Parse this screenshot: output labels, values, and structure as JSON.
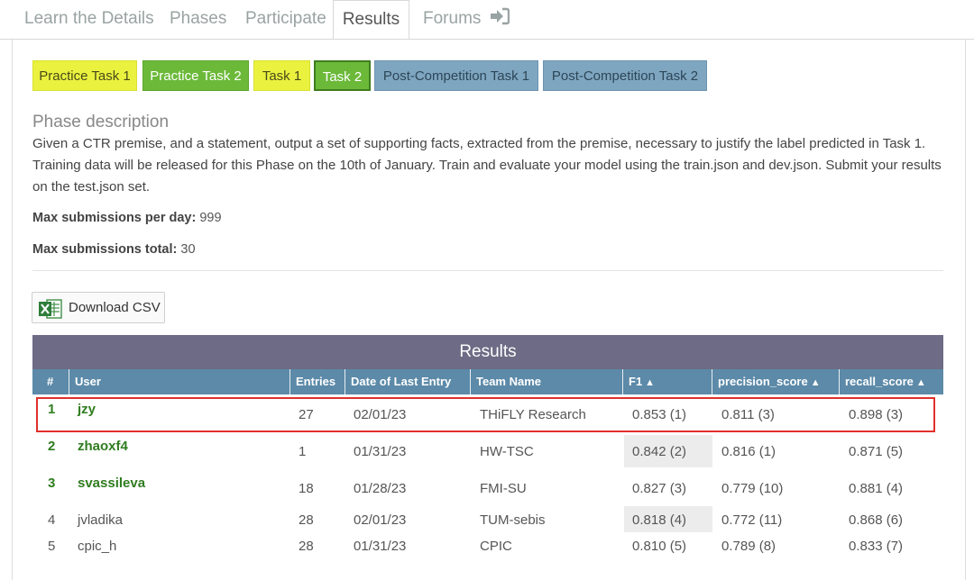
{
  "tabs": [
    {
      "label": "Learn the Details"
    },
    {
      "label": "Phases"
    },
    {
      "label": "Participate"
    },
    {
      "label": "Results"
    },
    {
      "label": "Forums"
    }
  ],
  "phase_buttons": [
    {
      "label": "Practice Task 1"
    },
    {
      "label": "Practice Task 2"
    },
    {
      "label": "Task 1"
    },
    {
      "label": "Task 2"
    },
    {
      "label": "Post-Competition Task 1"
    },
    {
      "label": "Post-Competition Task 2"
    }
  ],
  "phase": {
    "title": "Phase description",
    "description": "Given a CTR premise, and a statement, output a set of supporting facts, extracted from the premise, necessary to justify the label predicted in Task 1. Training data will be released for this Phase on the 10th of January. Train and evaluate your model using the train.json and dev.json. Submit your results on the test.json set.",
    "max_per_day_label": "Max submissions per day:",
    "max_per_day_value": "999",
    "max_total_label": "Max submissions total:",
    "max_total_value": "30"
  },
  "download_label": "Download CSV",
  "results": {
    "title": "Results",
    "columns": [
      "#",
      "User",
      "Entries",
      "Date of Last Entry",
      "Team Name",
      "F1",
      "precision_score",
      "recall_score"
    ],
    "rows": [
      {
        "rank": "1",
        "user": "jzy",
        "entries": "27",
        "date": "02/01/23",
        "team": "THiFLY Research",
        "f1": "0.853 (1)",
        "precision": "0.811 (3)",
        "recall": "0.898 (3)"
      },
      {
        "rank": "2",
        "user": "zhaoxf4",
        "entries": "1",
        "date": "01/31/23",
        "team": "HW-TSC",
        "f1": "0.842 (2)",
        "precision": "0.816 (1)",
        "recall": "0.871 (5)"
      },
      {
        "rank": "3",
        "user": "svassileva",
        "entries": "18",
        "date": "01/28/23",
        "team": "FMI-SU",
        "f1": "0.827 (3)",
        "precision": "0.779 (10)",
        "recall": "0.881 (4)"
      },
      {
        "rank": "4",
        "user": "jvladika",
        "entries": "28",
        "date": "02/01/23",
        "team": "TUM-sebis",
        "f1": "0.818 (4)",
        "precision": "0.772 (11)",
        "recall": "0.868 (6)"
      },
      {
        "rank": "5",
        "user": "cpic_h",
        "entries": "28",
        "date": "01/31/23",
        "team": "CPIC",
        "f1": "0.810 (5)",
        "precision": "0.789 (8)",
        "recall": "0.833 (7)"
      }
    ]
  }
}
